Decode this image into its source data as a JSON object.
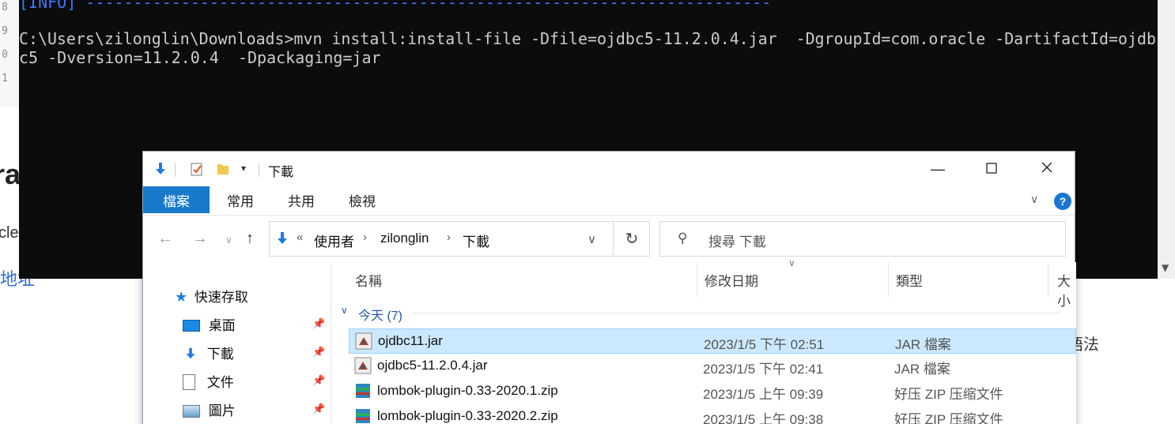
{
  "terminal": {
    "lines": [
      "[INFO] ------------------------------------------------------------------------",
      "",
      "C:\\Users\\zilonglin\\Downloads>mvn install:install-file -Dfile=ojdbc5-11.2.0.4.jar  -DgroupId=com.oracle -DartifactId=ojdb",
      "c5 -Dversion=11.2.0.4  -Dpackaging=jar"
    ]
  },
  "background": {
    "line_numbers": [
      "8",
      "9",
      "0",
      "1"
    ],
    "heading": "ra",
    "text1": "cle",
    "link": "地址",
    "right_text": "語法"
  },
  "explorer": {
    "title": "下載",
    "ribbon_tabs": [
      {
        "label": "檔案",
        "active": true
      },
      {
        "label": "常用",
        "active": false
      },
      {
        "label": "共用",
        "active": false
      },
      {
        "label": "檢視",
        "active": false
      }
    ],
    "help_label": "?",
    "address": {
      "overflow": "«",
      "segments": [
        "使用者",
        "zilonglin",
        "下載"
      ]
    },
    "search": {
      "placeholder": "搜尋 下載"
    },
    "sidebar": {
      "items": [
        {
          "label": "快速存取",
          "icon": "star-icon",
          "pinned": false
        },
        {
          "label": "桌面",
          "icon": "desktop-icon",
          "pinned": true
        },
        {
          "label": "下載",
          "icon": "download-icon",
          "pinned": true
        },
        {
          "label": "文件",
          "icon": "document-icon",
          "pinned": true
        },
        {
          "label": "圖片",
          "icon": "pictures-icon",
          "pinned": true
        }
      ]
    },
    "columns": [
      "名稱",
      "修改日期",
      "類型",
      "大小"
    ],
    "group_label": "今天 (7)",
    "files": [
      {
        "name": "ojdbc11.jar",
        "date": "2023/1/5 下午 02:51",
        "type": "JAR 檔案",
        "icon": "jar-icon",
        "selected": true
      },
      {
        "name": "ojdbc5-11.2.0.4.jar",
        "date": "2023/1/5 下午 02:41",
        "type": "JAR 檔案",
        "icon": "jar-icon",
        "selected": false
      },
      {
        "name": "lombok-plugin-0.33-2020.1.zip",
        "date": "2023/1/5 上午 09:39",
        "type": "好压 ZIP 压缩文件",
        "icon": "zip-icon",
        "selected": false
      },
      {
        "name": "lombok-plugin-0.33-2020.2.zip",
        "date": "2023/1/5 上午 09:38",
        "type": "好压 ZIP 压缩文件",
        "icon": "zip-icon",
        "selected": false
      }
    ]
  },
  "colors": {
    "terminal_bg": "#0c0c0c",
    "terminal_text": "#cccccc",
    "terminal_info": "#3b78ff",
    "ribbon_active": "#1979ca",
    "selection": "#cce8ff",
    "group_text": "#1e57a7"
  }
}
